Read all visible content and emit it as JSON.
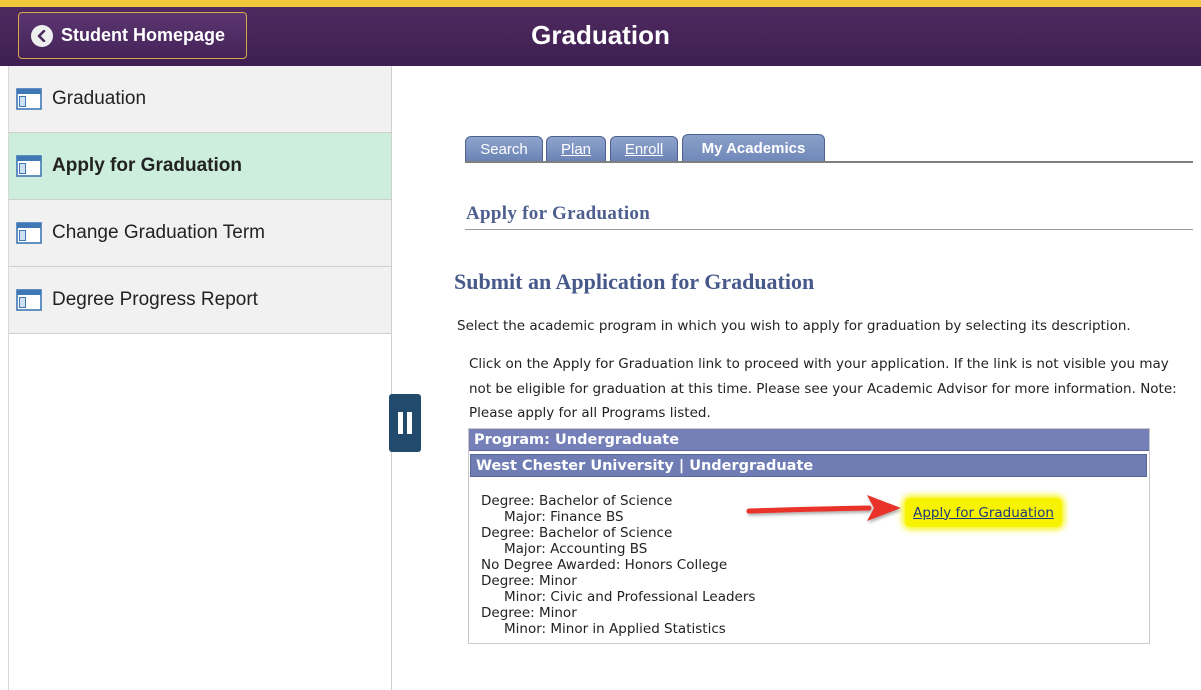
{
  "header": {
    "title": "Graduation",
    "home_button_label": "Student Homepage"
  },
  "sidebar": {
    "items": [
      {
        "label": "Graduation",
        "active": false
      },
      {
        "label": "Apply for Graduation",
        "active": true
      },
      {
        "label": "Change Graduation Term",
        "active": false
      },
      {
        "label": "Degree Progress Report",
        "active": false
      }
    ]
  },
  "tabs": [
    {
      "label": "Search",
      "active": false
    },
    {
      "label": "Plan",
      "active": false
    },
    {
      "label": "Enroll",
      "active": false
    },
    {
      "label": "My Academics",
      "active": true
    }
  ],
  "section": {
    "title": "Apply for Graduation"
  },
  "main": {
    "heading": "Submit an Application for Graduation",
    "instruction_1": "Select the academic program in which you wish to apply for graduation by selecting its description.",
    "instruction_2": "Click on the Apply for Graduation link to proceed with your application.  If the link is not visible you may not be eligible for graduation at this time.  Please see your Academic Advisor for more information. Note: Please apply for all Programs listed."
  },
  "program": {
    "header": "Program: Undergraduate",
    "institution": "West Chester University | Undergraduate",
    "lines": [
      {
        "text": "Degree: Bachelor of Science",
        "indent": false
      },
      {
        "text": "Major: Finance BS",
        "indent": true
      },
      {
        "text": "Degree: Bachelor of Science",
        "indent": false
      },
      {
        "text": "Major: Accounting BS",
        "indent": true
      },
      {
        "text": "No Degree Awarded: Honors College",
        "indent": false
      },
      {
        "text": "Degree: Minor",
        "indent": false
      },
      {
        "text": "Minor: Civic and Professional Leaders",
        "indent": true
      },
      {
        "text": "Degree: Minor",
        "indent": false
      },
      {
        "text": "Minor: Minor in Applied Statistics",
        "indent": true
      }
    ],
    "apply_link": "Apply for Graduation"
  },
  "colors": {
    "header_bg": "#4e2a5f",
    "header_accent": "#f0c83a",
    "active_nav_bg": "#cdeedd",
    "program_header_bg": "#7480b7",
    "highlight": "#f7f300",
    "annotation_arrow": "#e8332a"
  },
  "icons": {
    "home_button": "chevron-left-icon",
    "nav_item": "page-icon",
    "collapse": "pause-collapse-icon",
    "annotation": "red-arrow"
  }
}
